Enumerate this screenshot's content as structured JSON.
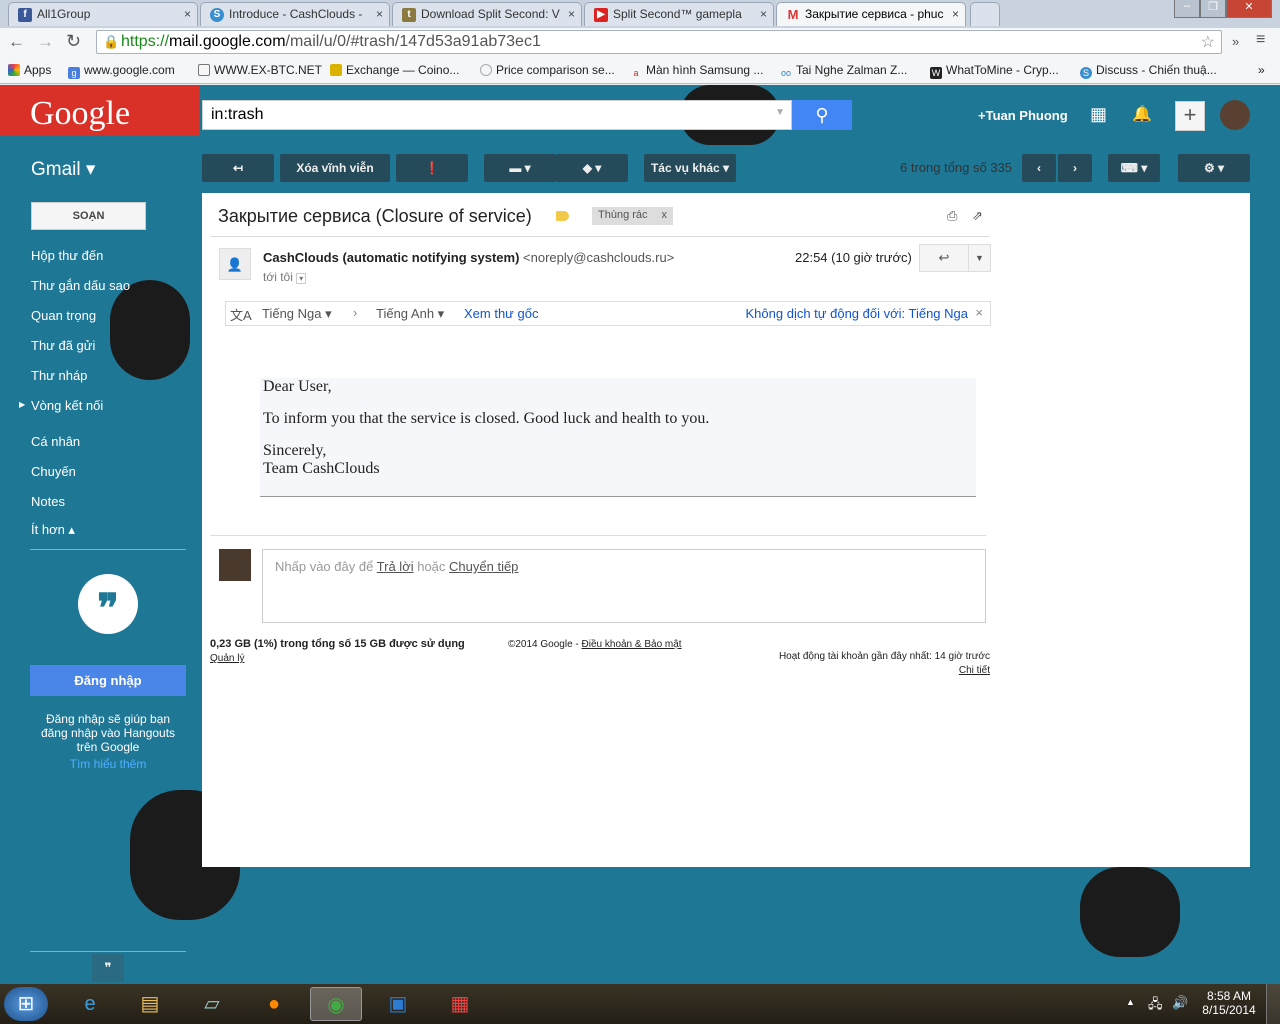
{
  "browser": {
    "tabs": [
      {
        "title": "All1Group",
        "icon": "facebook-icon"
      },
      {
        "title": "Introduce - CashClouds -",
        "icon": "cashclouds-icon"
      },
      {
        "title": "Download Split Second: V",
        "icon": "shield-icon"
      },
      {
        "title": "Split Second™ gamepla",
        "icon": "youtube-icon"
      },
      {
        "title": "Закрытие сервиса - phuc",
        "icon": "gmail-icon"
      }
    ],
    "url_scheme": "https://",
    "url_domain": "mail.google.com",
    "url_path": "/mail/u/0/#trash/147d53a91ab73ec1",
    "bookmarks": [
      "Apps",
      "www.google.com",
      "WWW.EX-BTC.NET",
      "Exchange — Coino...",
      "Price comparison se...",
      "Màn hình Samsung ...",
      "Tai Nghe Zalman Z...",
      "WhatToMine - Cryp...",
      "Discuss - Chiến thuậ..."
    ],
    "more": "»"
  },
  "header": {
    "logo": "Google",
    "search_value": "in:trash",
    "user": "+Tuan Phuong"
  },
  "toolbar": {
    "gmail": "Gmail ▾",
    "delete_forever": "Xóa vĩnh viễn",
    "more_actions": "Tác vụ khác ▾",
    "count": "6 trong tổng số 335"
  },
  "sidebar": {
    "compose": "SOẠN",
    "items": [
      "Hộp thư đến",
      "Thư gắn dấu sao",
      "Quan trọng",
      "Thư đã gửi",
      "Thư nháp",
      "Vòng kết nối",
      "Cá nhân",
      "Chuyến",
      "Notes",
      "Ít hơn ▴"
    ],
    "hangouts_signin": "Đăng nhập",
    "hangouts_text": "Đăng nhập sẽ giúp bạn đăng nhập vào Hangouts trên Google",
    "learn_more": "Tìm hiểu thêm"
  },
  "email": {
    "subject": "Закрытие сервиса (Closure of service)",
    "label": "Thùng rác",
    "sender_name": "CashClouds (automatic notifying system)",
    "sender_email": "<noreply@cashclouds.ru>",
    "time": "22:54 (10 giờ trước)",
    "to": "tới tôi",
    "translate": {
      "from": "Tiếng Nga ▾",
      "to": "Tiếng Anh ▾",
      "original": "Xem thư gốc",
      "no_auto": "Không dịch tự động đối với: Tiếng Nga"
    },
    "body": [
      "Dear User,",
      "To inform you that the service is closed. Good luck and health to you.",
      "Sincerely,",
      "Team CashClouds"
    ],
    "reply_prompt": "Nhấp vào đây để ",
    "reply": "Trả lời",
    "or": " hoặc ",
    "forward": "Chuyển tiếp"
  },
  "footer": {
    "storage": "0,23 GB (1%) trong tổng số 15 GB được sử dụng",
    "manage": "Quản lý",
    "copyright": "©2014 Google - ",
    "terms": "Điều khoản & Bảo mật",
    "activity": "Hoạt động tài khoản gần đây nhất: 14 giờ trước",
    "details": "Chi tiết"
  },
  "taskbar": {
    "time": "8:58 AM",
    "date": "8/15/2014"
  }
}
